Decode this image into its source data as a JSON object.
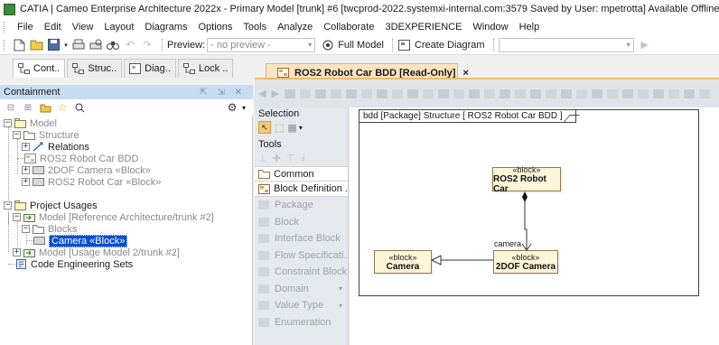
{
  "window": {
    "title": "CATIA | Cameo Enterprise Architecture 2022x - Primary Model [trunk] #6 [twcprod-2022.systemxi-internal.com:3579 Saved by User: mpetrotta]  Available Offline"
  },
  "menu": [
    "File",
    "Edit",
    "View",
    "Layout",
    "Diagrams",
    "Options",
    "Tools",
    "Analyze",
    "Collaborate",
    "3DEXPERIENCE",
    "Window",
    "Help"
  ],
  "toolbar": {
    "preview_label": "Preview:",
    "preview_value": "- no preview -",
    "full_model_label": "Full Model",
    "create_diagram_label": "Create Diagram"
  },
  "left_tabs": [
    "Cont..",
    "Struc..",
    "Diag..",
    "Lock .."
  ],
  "containment": {
    "title": "Containment",
    "tree": [
      {
        "label": "Model"
      },
      {
        "label": "Structure"
      },
      {
        "label": "Relations"
      },
      {
        "label": "ROS2 Robot Car BDD"
      },
      {
        "label": "2DOF Camera «Block»"
      },
      {
        "label": "ROS2 Robot Car «Block»"
      },
      {
        "label": "Project Usages"
      },
      {
        "label": "Model [Reference Architecture/trunk #2]"
      },
      {
        "label": "Blocks"
      },
      {
        "label": "Camera «Block»"
      },
      {
        "label": "Model [Usage Model 2/trunk #2]"
      },
      {
        "label": "Code Engineering Sets"
      }
    ]
  },
  "document_tab": {
    "title": "ROS2 Robot Car BDD [Read-Only]",
    "close": "×"
  },
  "palette": {
    "selection_label": "Selection",
    "tools_label": "Tools",
    "groups": [
      "Common",
      "Block Definition ..."
    ],
    "items": [
      "Package",
      "Block",
      "Interface Block",
      "Flow Specificati...",
      "Constraint Block",
      "Domain",
      "Value Type",
      "Enumeration"
    ]
  },
  "diagram": {
    "frame_label": "bdd [Package] Structure [ ROS2 Robot Car BDD ]",
    "blocks": [
      {
        "stereotype": "«block»",
        "name": "ROS2 Robot Car"
      },
      {
        "stereotype": "«block»",
        "name": "Camera"
      },
      {
        "stereotype": "«block»",
        "name": "2DOF Camera"
      }
    ],
    "association_role": "camera"
  },
  "colors": {
    "selection_blue": "#0a4fcf",
    "doc_tab": "#fbe4c3",
    "block_fill": "#fff5d9",
    "containment_header": "#c7dcf2"
  }
}
